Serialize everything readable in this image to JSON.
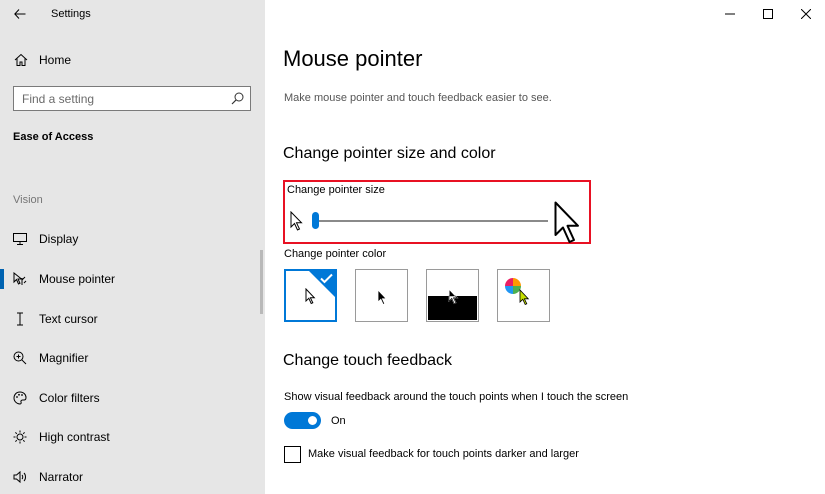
{
  "window": {
    "app_title": "Settings"
  },
  "sidebar": {
    "home_label": "Home",
    "search_placeholder": "Find a setting",
    "section_title": "Ease of Access",
    "group_vision": "Vision",
    "items": [
      {
        "label": "Display",
        "icon": "monitor-icon"
      },
      {
        "label": "Mouse pointer",
        "icon": "mouse-pointer-icon",
        "active": true
      },
      {
        "label": "Text cursor",
        "icon": "text-cursor-icon"
      },
      {
        "label": "Magnifier",
        "icon": "magnifier-icon"
      },
      {
        "label": "Color filters",
        "icon": "color-filters-icon"
      },
      {
        "label": "High contrast",
        "icon": "high-contrast-icon"
      },
      {
        "label": "Narrator",
        "icon": "narrator-icon"
      }
    ]
  },
  "main": {
    "title": "Mouse pointer",
    "description": "Make mouse pointer and touch feedback easier to see.",
    "size_color_heading": "Change pointer size and color",
    "pointer_size_label": "Change pointer size",
    "pointer_size_value": 0.0,
    "pointer_color_label": "Change pointer color",
    "color_options": [
      "white",
      "black",
      "inverted",
      "custom"
    ],
    "selected_color": "white",
    "touch_heading": "Change touch feedback",
    "touch_description": "Show visual feedback around the touch points when I touch the screen",
    "touch_toggle_state": "On",
    "touch_checkbox_label": "Make visual feedback for touch points darker and larger",
    "touch_checkbox_checked": false
  },
  "colors": {
    "accent": "#0078d7",
    "highlight_border": "#e81123",
    "sidebar_bg": "#e6e6e6"
  }
}
